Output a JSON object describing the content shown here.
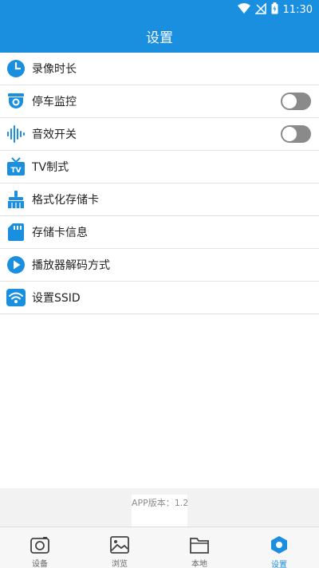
{
  "status_bar": {
    "time": "11:30",
    "icons": [
      "wifi-icon",
      "no-signal-icon",
      "battery-charging-icon"
    ]
  },
  "header": {
    "title": "设置"
  },
  "settings": {
    "items": [
      {
        "label": "录像时长",
        "icon": "clock-icon"
      },
      {
        "label": "停车监控",
        "icon": "camera-monitor-icon",
        "toggle": "off"
      },
      {
        "label": "音效开关",
        "icon": "sound-wave-icon",
        "toggle": "off"
      },
      {
        "label": "TV制式",
        "icon": "tv-icon"
      },
      {
        "label": "格式化存储卡",
        "icon": "broom-icon"
      },
      {
        "label": "存储卡信息",
        "icon": "sd-card-icon"
      },
      {
        "label": "播放器解码方式",
        "icon": "play-icon"
      },
      {
        "label": "设置SSID",
        "icon": "wifi-icon"
      }
    ]
  },
  "footer": {
    "version": "APP版本：1.2"
  },
  "tabs": [
    {
      "label": "设备",
      "icon": "camera-icon",
      "active": false
    },
    {
      "label": "浏览",
      "icon": "image-icon",
      "active": false
    },
    {
      "label": "本地",
      "icon": "folder-icon",
      "active": false
    },
    {
      "label": "设置",
      "icon": "settings-hexagon-icon",
      "active": true
    }
  ],
  "colors": {
    "primary": "#1a8fe0",
    "toggle_off": "#8a8a8a",
    "tab_inactive": "#666666"
  }
}
